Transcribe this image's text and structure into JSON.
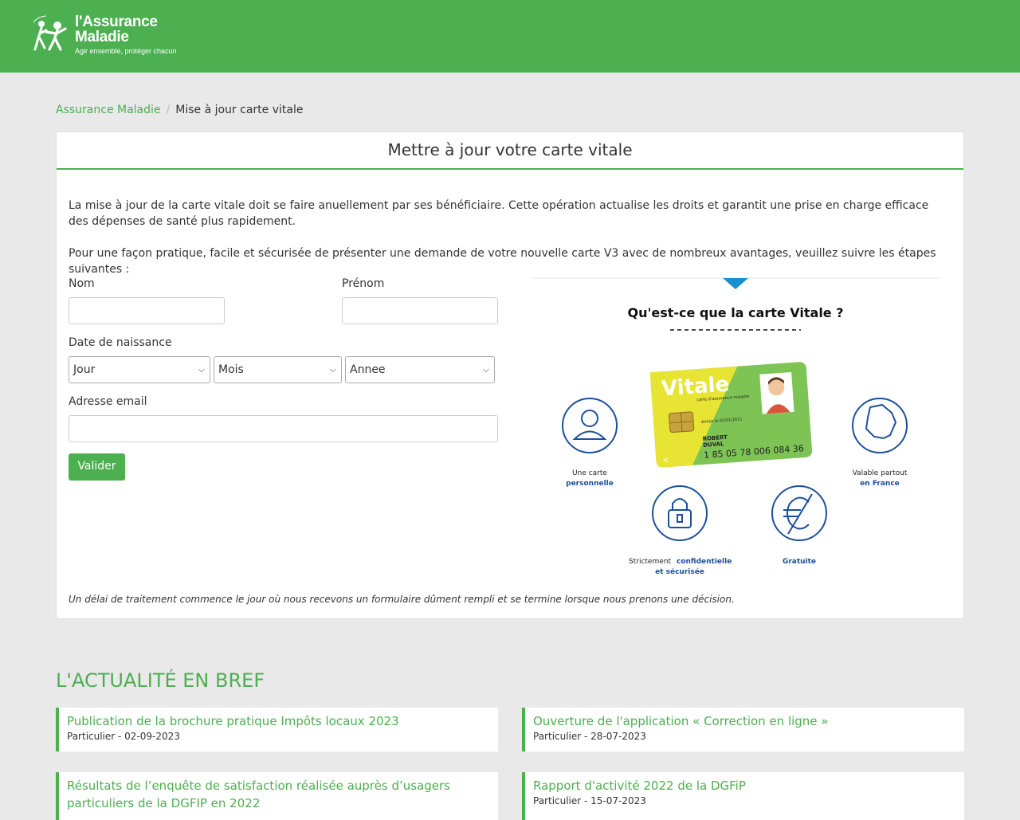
{
  "header": {
    "logo_line1": "l'Assurance",
    "logo_line2": "Maladie",
    "logo_tagline": "Agir ensemble, protéger chacun",
    "brand_color": "#4caf50"
  },
  "breadcrumb": {
    "home": "Assurance Maladie",
    "separator": "/",
    "current": "Mise à jour carte vitale"
  },
  "card": {
    "title": "Mettre à jour votre carte vitale",
    "intro1": "La mise à jour de la carte vitale doit se faire anuellement par ses bénéficiaire. Cette opération actualise les droits et garantit une prise en charge efficace des dépenses de santé plus rapidement.",
    "intro2": "Pour une façon pratique, facile et sécurisée de présenter une demande de votre nouvelle carte V3 avec de nombreux avantages, veuillez suivre les étapes suivantes :",
    "footnote": "Un délai de traitement commence le jour où nous recevons un formulaire dûment rempli et se termine lorsque nous prenons une décision."
  },
  "form": {
    "nom_label": "Nom",
    "nom_value": "",
    "prenom_label": "Prénom",
    "prenom_value": "",
    "dob_label": "Date de naissance",
    "day_selected": "Jour",
    "month_selected": "Mois",
    "year_selected": "Annee",
    "email_label": "Adresse email",
    "email_value": "",
    "submit_label": "Valider"
  },
  "infographic": {
    "title": "Qu'est-ce que la carte Vitale ?",
    "card_brand": "Vitale",
    "card_subtitle": "carte d'assurance maladie",
    "card_issue": "émise le 01/01/2011",
    "card_name1": "ROBERT",
    "card_name2": "DUVAL",
    "card_number": "1 85 05 78 006 084 36",
    "feat1_a": "Une carte",
    "feat1_b": "personnelle",
    "feat2_a": "Valable partout",
    "feat2_b": "en France",
    "feat3_a": "Strictement",
    "feat3_b": "confidentielle",
    "feat3_c": "et sécurisée",
    "feat4": "Gratuite",
    "accent": "#1d4f9c",
    "marker_color": "#1b8fd0"
  },
  "news": {
    "heading": "L'ACTUALITÉ EN BREF",
    "items": [
      {
        "title": "Publication de la brochure pratique Impôts locaux 2023",
        "meta": "Particulier - 02-09-2023"
      },
      {
        "title": "Ouverture de l'application « Correction en ligne »",
        "meta": "Particulier - 28-07-2023"
      },
      {
        "title": "Résultats de l’enquête de satisfaction réalisée auprès d’usagers particuliers de la DGFIP en 2022",
        "meta": ""
      },
      {
        "title": "Rapport d'activité 2022 de la DGFiP",
        "meta": "Particulier - 15-07-2023"
      }
    ]
  }
}
